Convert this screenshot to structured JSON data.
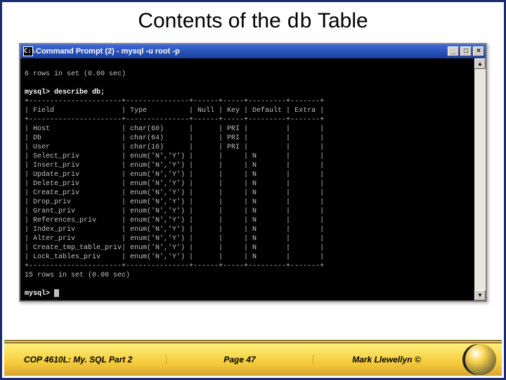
{
  "title_prefix": "Contents of the ",
  "title_mono": "db",
  "title_suffix": " Table",
  "window": {
    "title": "Command Prompt (2) - mysql -u root -p",
    "controls": {
      "min": "_",
      "max": "□",
      "close": "×"
    },
    "scroll": {
      "up": "▲",
      "down": "▼"
    }
  },
  "terminal": {
    "rows_in_set_top": "6 rows in set (0.00 sec)",
    "prompt1": "mysql> describe db;",
    "sep": "+----------------------+---------------+------+-----+---------+-------+",
    "hdr": "| Field                | Type          | Null | Key | Default | Extra |",
    "r01": "| Host                 | char(60)      |      | PRI |         |       |",
    "r02": "| Db                   | char(64)      |      | PRI |         |       |",
    "r03": "| User                 | char(16)      |      | PRI |         |       |",
    "r04": "| Select_priv          | enum('N','Y') |      |     | N       |       |",
    "r05": "| Insert_priv          | enum('N','Y') |      |     | N       |       |",
    "r06": "| Update_priv          | enum('N','Y') |      |     | N       |       |",
    "r07": "| Delete_priv          | enum('N','Y') |      |     | N       |       |",
    "r08": "| Create_priv          | enum('N','Y') |      |     | N       |       |",
    "r09": "| Drop_priv            | enum('N','Y') |      |     | N       |       |",
    "r10": "| Grant_priv           | enum('N','Y') |      |     | N       |       |",
    "r11": "| References_priv      | enum('N','Y') |      |     | N       |       |",
    "r12": "| Index_priv           | enum('N','Y') |      |     | N       |       |",
    "r13": "| Alter_priv           | enum('N','Y') |      |     | N       |       |",
    "r14": "| Create_tmp_table_priv| enum('N','Y') |      |     | N       |       |",
    "r15": "| Lock_tables_priv     | enum('N','Y') |      |     | N       |       |",
    "rows_in_set_bottom": "15 rows in set (0.00 sec)",
    "prompt2": "mysql> "
  },
  "footer": {
    "left": "COP 4610L: My. SQL Part 2",
    "center": "Page 47",
    "right": "Mark Llewellyn ©"
  }
}
